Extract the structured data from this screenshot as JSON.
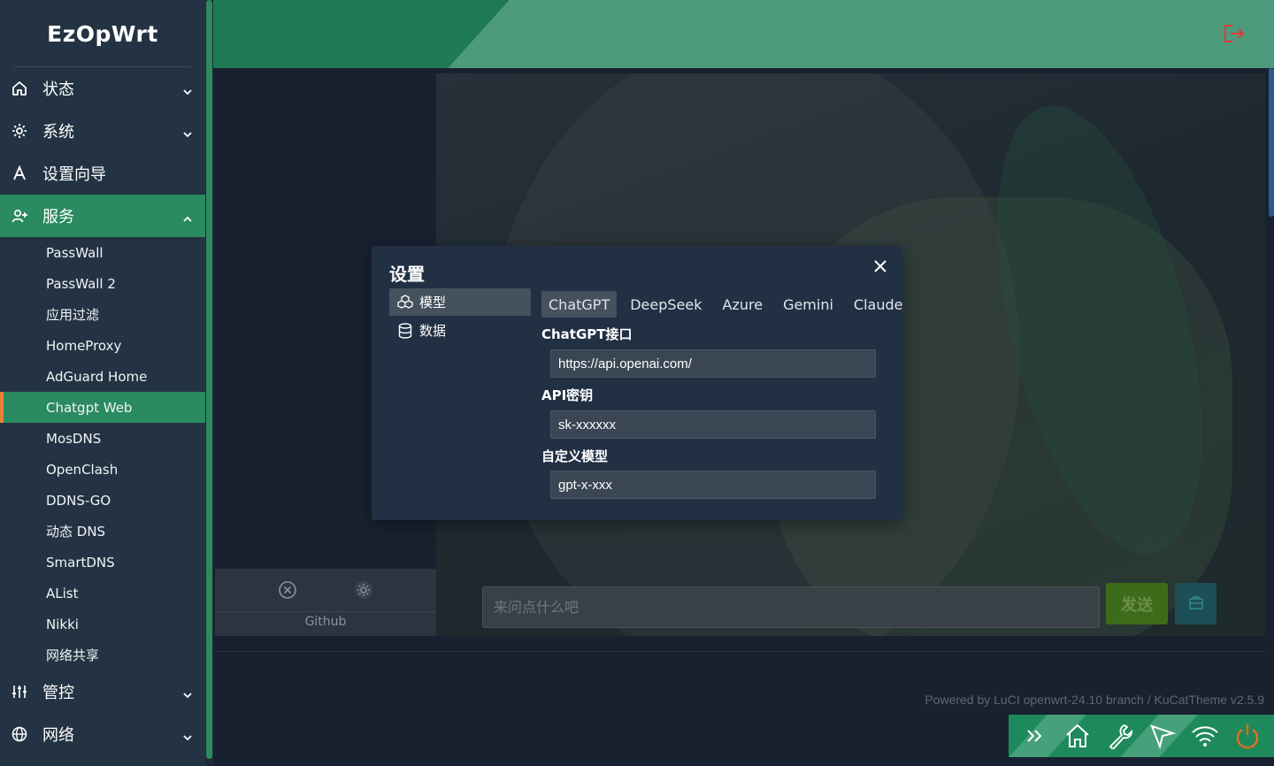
{
  "app": {
    "brand": "EzOpWrt"
  },
  "sidebar": {
    "menu_top": [
      {
        "label": "状态",
        "icon": "home-icon",
        "expandable": true
      },
      {
        "label": "系统",
        "icon": "gear-icon",
        "expandable": true
      },
      {
        "label": "设置向导",
        "icon": "wizard-icon",
        "expandable": false
      }
    ],
    "services": {
      "label": "服务",
      "icon": "user-plus-icon",
      "items": [
        "PassWall",
        "PassWall 2",
        "应用过滤",
        "HomeProxy",
        "AdGuard Home",
        "Chatgpt Web",
        "MosDNS",
        "OpenClash",
        "DDNS-GO",
        "动态 DNS",
        "SmartDNS",
        "AList",
        "Nikki",
        "网络共享"
      ],
      "active_item": "Chatgpt Web"
    },
    "menu_bottom": [
      {
        "label": "管控",
        "icon": "sliders-icon",
        "expandable": true
      },
      {
        "label": "网络",
        "icon": "globe-icon",
        "expandable": true
      }
    ]
  },
  "header": {
    "logout_icon": "logout-icon",
    "logout_color": "#e53935"
  },
  "chat": {
    "input_placeholder": "来问点什么吧",
    "input_value": "",
    "send_label": "发送",
    "github_label": "Github"
  },
  "footer": {
    "text": "Powered by LuCI openwrt-24.10 branch / KuCatTheme v2.5.9"
  },
  "settings_modal": {
    "title": "设置",
    "nav": [
      {
        "label": "模型",
        "icon": "cubes-icon",
        "active": true
      },
      {
        "label": "数据",
        "icon": "database-icon",
        "active": false
      }
    ],
    "model_tabs": [
      "ChatGPT",
      "DeepSeek",
      "Azure",
      "Gemini",
      "Claude"
    ],
    "active_tab": "ChatGPT",
    "fields": {
      "endpoint_label": "ChatGPT接口",
      "endpoint_value": "https://api.openai.com/",
      "key_label": "API密钥",
      "key_value": "sk-xxxxxx",
      "custom_model_label": "自定义模型",
      "custom_model_value": "gpt-x-xxx"
    }
  },
  "colors": {
    "sidebar_bg": "#243343",
    "accent_green": "#2a8a60",
    "active_marker": "#e8823a",
    "header_green": "#1e7a56",
    "modal_bg": "#223044"
  }
}
